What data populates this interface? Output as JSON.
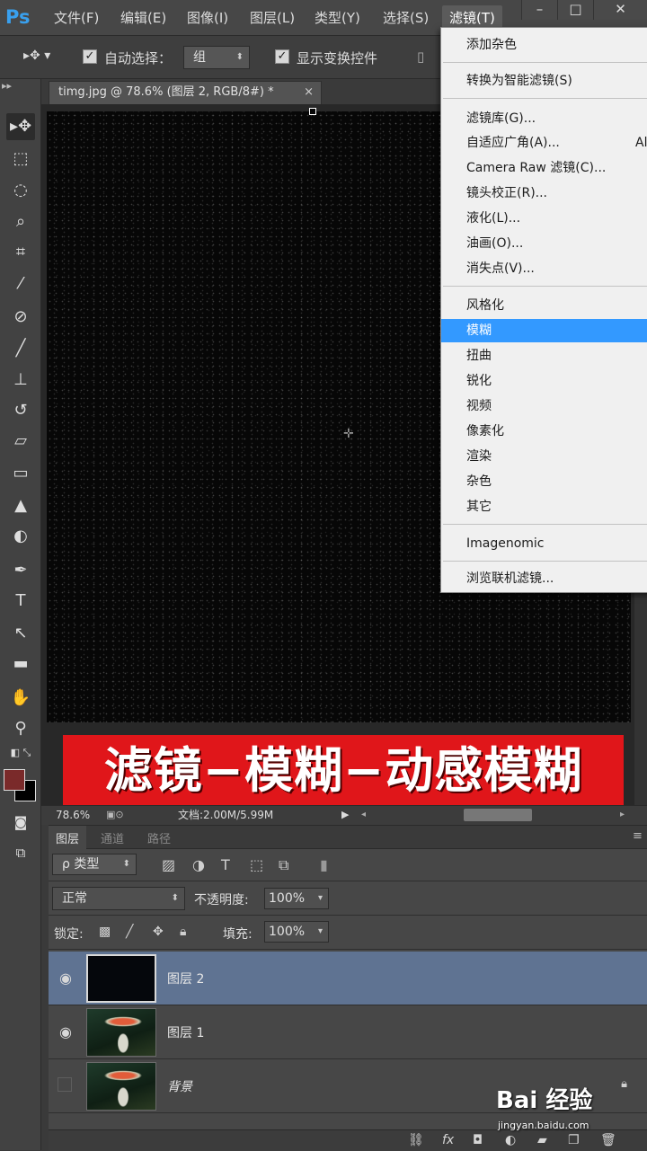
{
  "app": {
    "logo": "Ps",
    "menu": [
      "文件(F)",
      "编辑(E)",
      "图像(I)",
      "图层(L)",
      "类型(Y)",
      "选择(S)",
      "滤镜(T)"
    ],
    "window_controls": [
      "–",
      "□",
      "✕"
    ]
  },
  "options_bar": {
    "auto_select_label": "自动选择：",
    "auto_select_checked": true,
    "auto_select_value": "组",
    "show_transform_label": "显示变换控件",
    "show_transform_checked": true
  },
  "document": {
    "tab_title": "timg.jpg @ 78.6% (图层 2, RGB/8#) *",
    "close": "×"
  },
  "filter_menu": {
    "groups": [
      [
        "添加杂色"
      ],
      [
        "转换为智能滤镜(S)"
      ],
      [
        "滤镜库(G)...",
        "自适应广角(A)...",
        "Camera Raw 滤镜(C)...",
        "镜头校正(R)...",
        "液化(L)...",
        "油画(O)...",
        "消失点(V)..."
      ],
      [
        "风格化",
        "模糊",
        "扭曲",
        "锐化",
        "视频",
        "像素化",
        "渲染",
        "杂色",
        "其它"
      ],
      [
        "Imagenomic"
      ],
      [
        "浏览联机滤镜..."
      ]
    ],
    "highlighted": "模糊",
    "partial_shortcut": "Al"
  },
  "banner": {
    "text": "滤镜−模糊−动感模糊",
    "color": "#e0161a"
  },
  "status_bar": {
    "zoom": "78.6%",
    "doc_info": "文档:2.00M/5.99M"
  },
  "layers_panel": {
    "tabs": [
      "图层",
      "通道",
      "路径"
    ],
    "active_tab": "图层",
    "filter_kind": "ρ 类型",
    "blend_mode": "正常",
    "opacity_label": "不透明度:",
    "opacity_value": "100%",
    "lock_label": "锁定:",
    "fill_label": "填充:",
    "fill_value": "100%",
    "layers": [
      {
        "name": "图层 2",
        "selected": true,
        "visible": true
      },
      {
        "name": "图层 1",
        "selected": false,
        "visible": true
      },
      {
        "name": "背景",
        "selected": false,
        "visible": false,
        "locked": true
      }
    ]
  },
  "watermark": {
    "brand": "Bai 经验",
    "url": "jingyan.baidu.com"
  }
}
